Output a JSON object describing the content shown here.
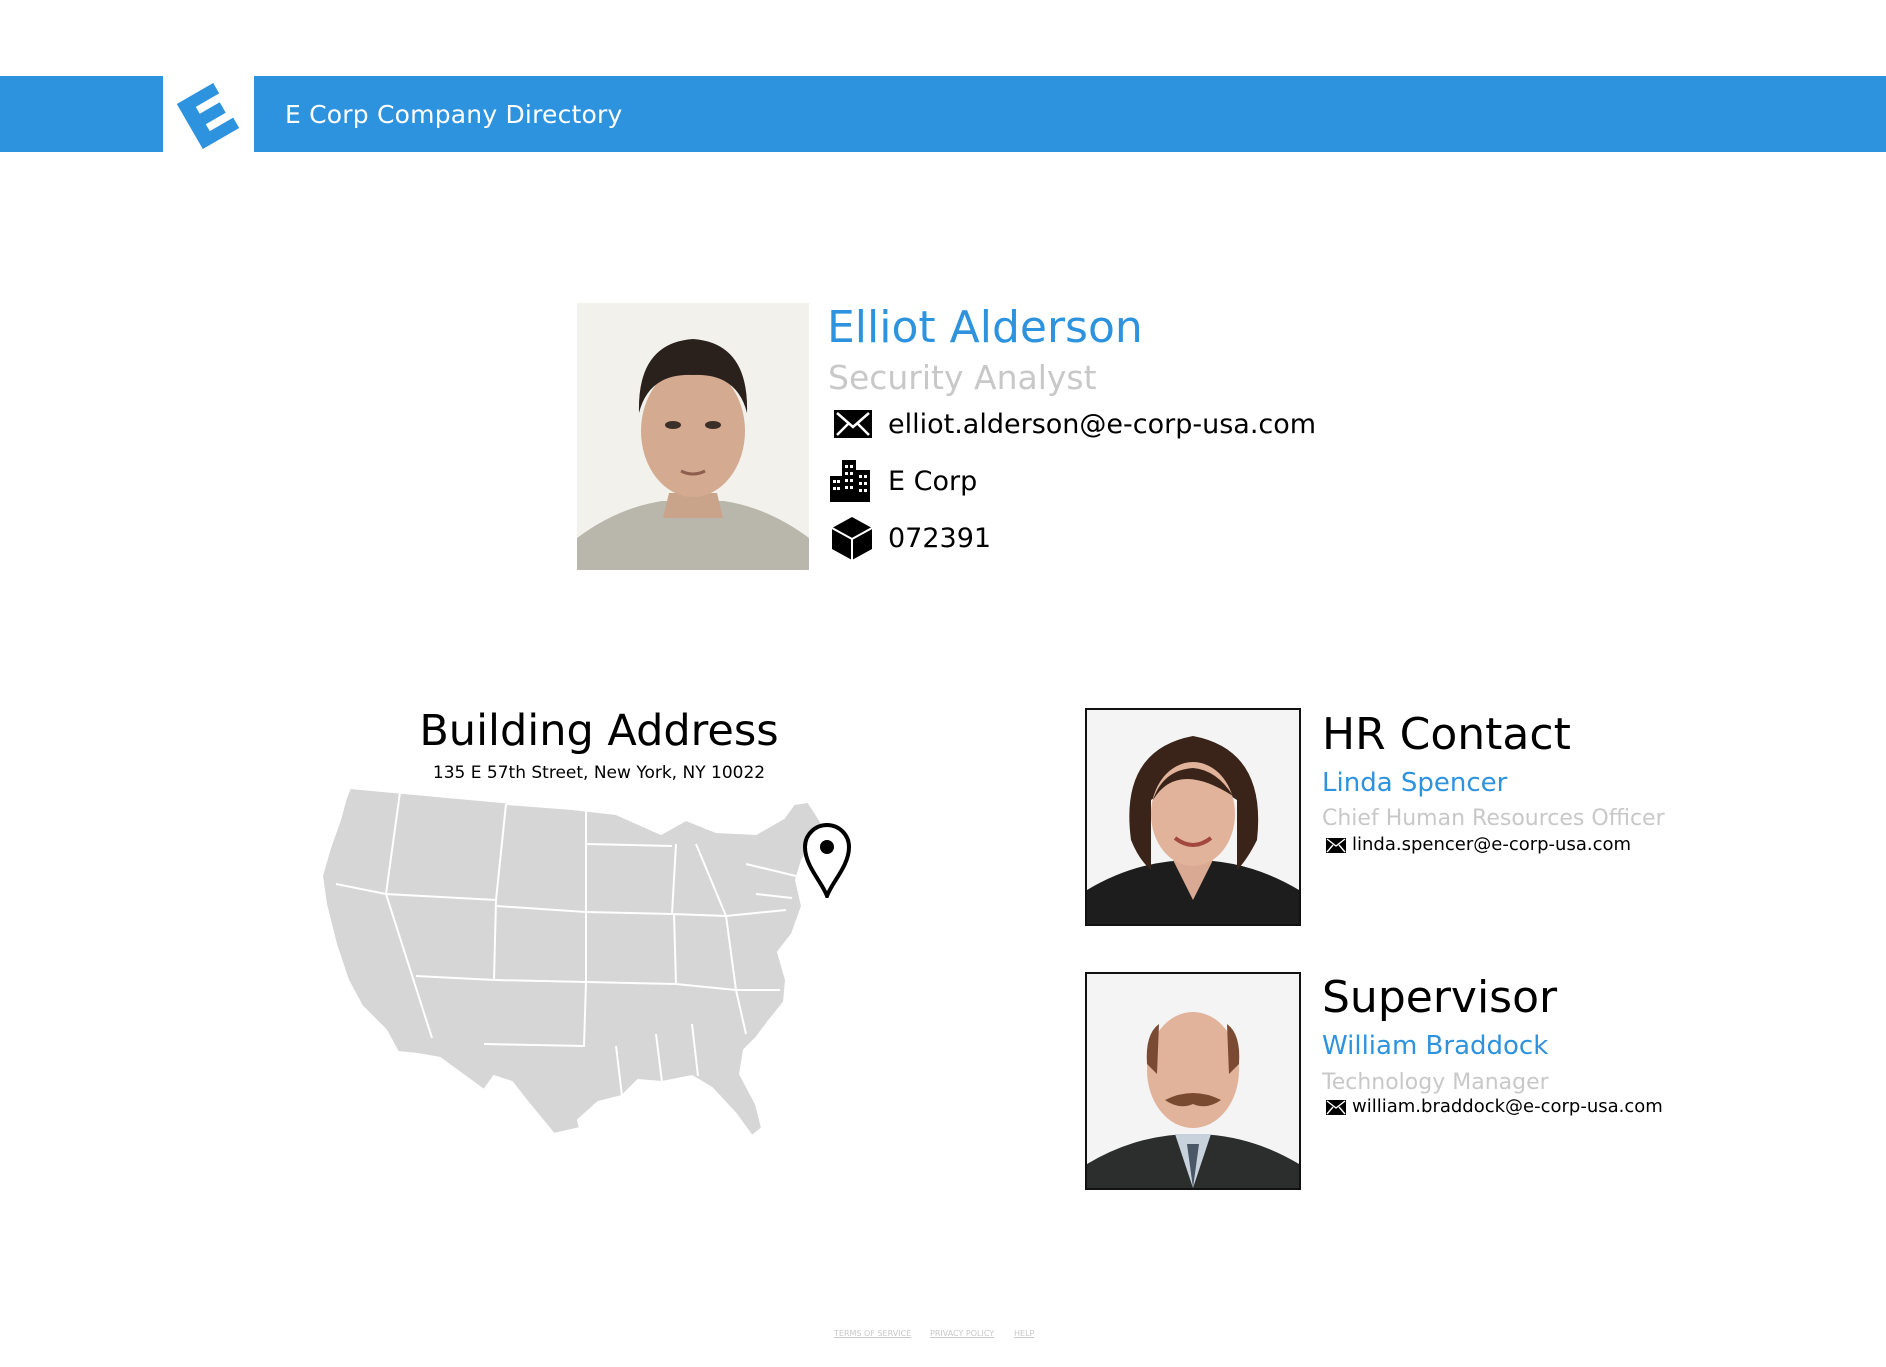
{
  "header": {
    "title": "E Corp Company Directory",
    "logo_icon": "e-corp-logo-icon",
    "bar_color": "#2e93de"
  },
  "profile": {
    "name": "Elliot Alderson",
    "job_title": "Security Analyst",
    "email": "elliot.alderson@e-corp-usa.com",
    "company": "E Corp",
    "employee_id": "072391",
    "email_icon": "envelope-icon",
    "company_icon": "buildings-icon",
    "id_icon": "cube-icon"
  },
  "building": {
    "heading": "Building Address",
    "address": "135 E 57th Street, New York, NY 10022",
    "map_icon": "us-map",
    "pin_icon": "map-pin-icon"
  },
  "hr_contact": {
    "heading": "HR Contact",
    "name": "Linda Spencer",
    "role": "Chief Human Resources Officer",
    "email": "linda.spencer@e-corp-usa.com"
  },
  "supervisor": {
    "heading": "Supervisor",
    "name": "William Braddock",
    "role": "Technology Manager",
    "email": "william.braddock@e-corp-usa.com"
  },
  "footer": {
    "links": [
      "TERMS OF SERVICE",
      "PRIVACY POLICY",
      "HELP"
    ]
  },
  "colors": {
    "accent": "#2e93de",
    "muted_text": "#c8c8c8",
    "map_fill": "#d6d6d6"
  }
}
